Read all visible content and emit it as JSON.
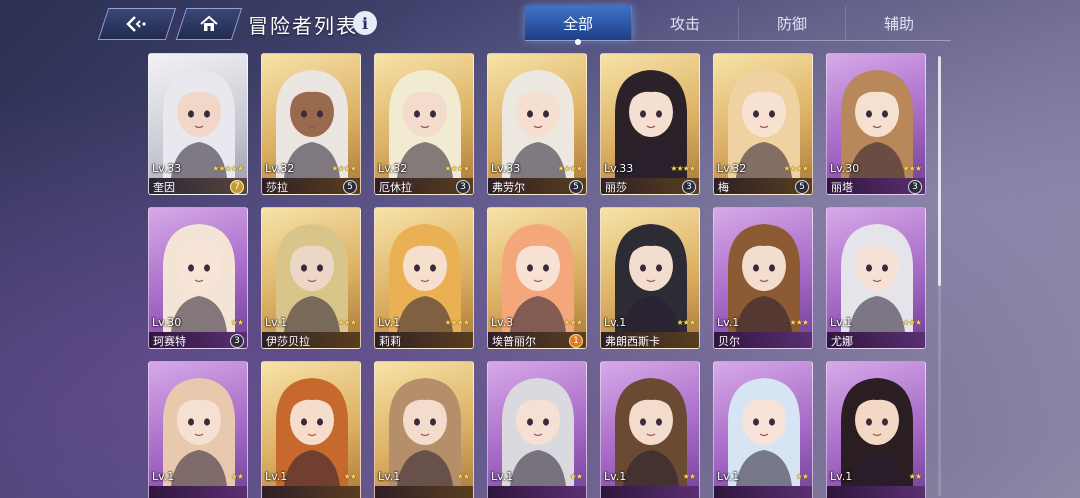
{
  "header": {
    "title": "冒险者列表",
    "info_icon": "i",
    "back_icon": "back-arrow-icon",
    "home_icon": "home-icon"
  },
  "tabs": [
    {
      "label": "全部",
      "active": true
    },
    {
      "label": "攻击",
      "active": false
    },
    {
      "label": "防御",
      "active": false
    },
    {
      "label": "辅助",
      "active": false
    }
  ],
  "colors": {
    "gold_frame": "#dcb064",
    "purple_frame": "#a66ac7",
    "silver_frame": "#c8c8d2",
    "active_tab": "#3d74c9",
    "star": "#ffd94a"
  },
  "characters": [
    {
      "lv": "Lv.33",
      "name": "奎因",
      "stars": "★★★★★",
      "badge": "7",
      "frame": "silver",
      "badge_style": "gold-badge",
      "hair": "#e8e8ee",
      "skin": "#f1d7c8"
    },
    {
      "lv": "Lv.32",
      "name": "莎拉",
      "stars": "★★★★",
      "badge": "5",
      "frame": "gold",
      "badge_style": "",
      "hair": "#ece6e2",
      "skin": "#9a6a4e"
    },
    {
      "lv": "Lv.32",
      "name": "厄休拉",
      "stars": "★★★★",
      "badge": "3",
      "frame": "gold",
      "badge_style": "",
      "hair": "#f1ebd2",
      "skin": "#f3dccb"
    },
    {
      "lv": "Lv.33",
      "name": "弗劳尔",
      "stars": "★★★★",
      "badge": "5",
      "frame": "gold",
      "badge_style": "",
      "hair": "#ece8e0",
      "skin": "#f5dfd0"
    },
    {
      "lv": "Lv.33",
      "name": "丽莎",
      "stars": "★★★★",
      "badge": "3",
      "frame": "gold",
      "badge_style": "",
      "hair": "#2a2228",
      "skin": "#f5dfd0"
    },
    {
      "lv": "Lv.32",
      "name": "梅",
      "stars": "★★★★",
      "badge": "5",
      "frame": "gold",
      "badge_style": "",
      "hair": "#f0d1a2",
      "skin": "#f7e2d2"
    },
    {
      "lv": "Lv.30",
      "name": "丽塔",
      "stars": "★★★",
      "badge": "3",
      "frame": "purple",
      "badge_style": "",
      "hair": "#b8875a",
      "skin": "#f6e0d0"
    },
    {
      "lv": "Lv.30",
      "name": "珂赛特",
      "stars": "★★",
      "badge": "3",
      "frame": "purple",
      "badge_style": "",
      "hair": "#f4e4d6",
      "skin": "#f8e5d8"
    },
    {
      "lv": "Lv.1",
      "name": "伊莎贝拉",
      "stars": "★★★",
      "badge": "",
      "frame": "gold",
      "badge_style": "",
      "hair": "#d9c58a",
      "skin": "#ecd6c6"
    },
    {
      "lv": "Lv.1",
      "name": "莉莉",
      "stars": "★★★★",
      "badge": "",
      "frame": "gold",
      "badge_style": "",
      "hair": "#e9b154",
      "skin": "#f6dfcd"
    },
    {
      "lv": "Lv.3",
      "name": "埃普丽尔",
      "stars": "★★★",
      "badge": "1",
      "frame": "gold",
      "badge_style": "orange",
      "hair": "#f3a77a",
      "skin": "#f8e2d4"
    },
    {
      "lv": "Lv.1",
      "name": "弗朗西斯卡",
      "stars": "★★★",
      "badge": "",
      "frame": "gold",
      "badge_style": "",
      "hair": "#2d2b33",
      "skin": "#f3ddcf"
    },
    {
      "lv": "Lv.1",
      "name": "贝尔",
      "stars": "★★★",
      "badge": "",
      "frame": "purple",
      "badge_style": "",
      "hair": "#8c5a33",
      "skin": "#f3ddcc"
    },
    {
      "lv": "Lv.1",
      "name": "尤娜",
      "stars": "★★★",
      "badge": "",
      "frame": "purple",
      "badge_style": "",
      "hair": "#e4e4ea",
      "skin": "#f6e2d6"
    },
    {
      "lv": "Lv.1",
      "name": "",
      "stars": "★★",
      "badge": "",
      "frame": "purple",
      "badge_style": "",
      "hair": "#e9c9ad",
      "skin": "#f6e0d2"
    },
    {
      "lv": "Lv.1",
      "name": "",
      "stars": "★★",
      "badge": "",
      "frame": "gold",
      "badge_style": "",
      "hair": "#c7692d",
      "skin": "#f6dccb"
    },
    {
      "lv": "Lv.1",
      "name": "",
      "stars": "★★",
      "badge": "",
      "frame": "gold",
      "badge_style": "",
      "hair": "#b58f6a",
      "skin": "#f4dccc"
    },
    {
      "lv": "Lv.1",
      "name": "",
      "stars": "★★",
      "badge": "",
      "frame": "purple",
      "badge_style": "",
      "hair": "#d9d9de",
      "skin": "#f5e0d3"
    },
    {
      "lv": "Lv.1",
      "name": "",
      "stars": "★★",
      "badge": "",
      "frame": "purple",
      "badge_style": "",
      "hair": "#6a4a32",
      "skin": "#f3dccc"
    },
    {
      "lv": "Lv.1",
      "name": "",
      "stars": "★★",
      "badge": "",
      "frame": "purple",
      "badge_style": "",
      "hair": "#d6e4f4",
      "skin": "#f7e3d7"
    },
    {
      "lv": "Lv.1",
      "name": "",
      "stars": "★★",
      "badge": "",
      "frame": "purple",
      "badge_style": "",
      "hair": "#2a1e22",
      "skin": "#f4d8c6"
    }
  ]
}
